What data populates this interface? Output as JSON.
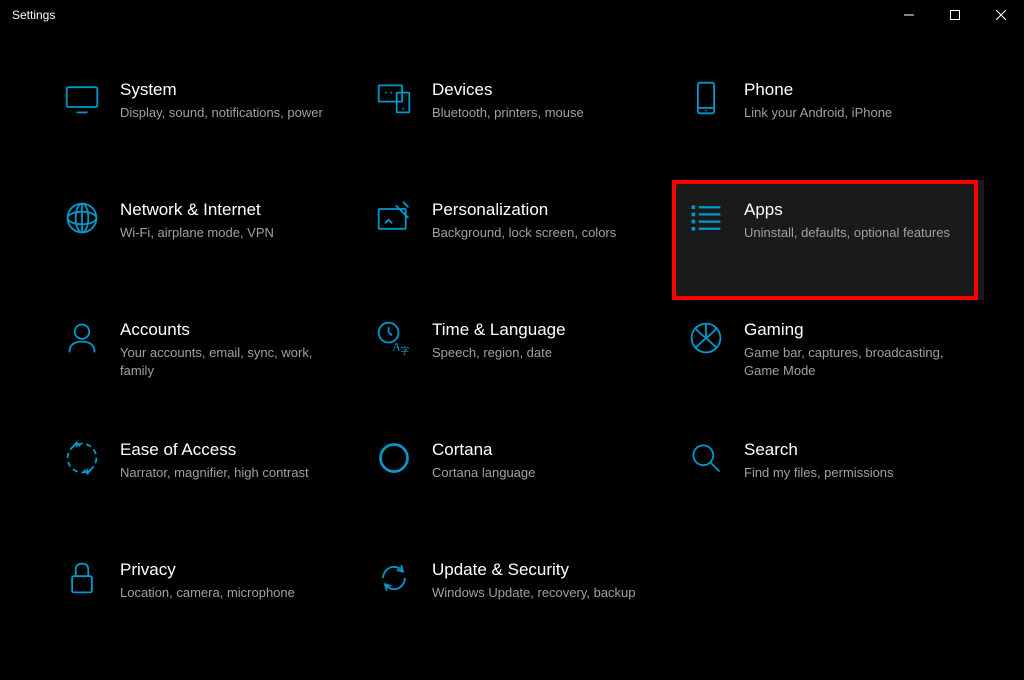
{
  "window": {
    "title": "Settings"
  },
  "categories": [
    {
      "title": "System",
      "description": "Display, sound, notifications, power"
    },
    {
      "title": "Devices",
      "description": "Bluetooth, printers, mouse"
    },
    {
      "title": "Phone",
      "description": "Link your Android, iPhone"
    },
    {
      "title": "Network & Internet",
      "description": "Wi-Fi, airplane mode, VPN"
    },
    {
      "title": "Personalization",
      "description": "Background, lock screen, colors"
    },
    {
      "title": "Apps",
      "description": "Uninstall, defaults, optional features"
    },
    {
      "title": "Accounts",
      "description": "Your accounts, email, sync, work, family"
    },
    {
      "title": "Time & Language",
      "description": "Speech, region, date"
    },
    {
      "title": "Gaming",
      "description": "Game bar, captures, broadcasting, Game Mode"
    },
    {
      "title": "Ease of Access",
      "description": "Narrator, magnifier, high contrast"
    },
    {
      "title": "Cortana",
      "description": "Cortana language"
    },
    {
      "title": "Search",
      "description": "Find my files, permissions"
    },
    {
      "title": "Privacy",
      "description": "Location, camera, microphone"
    },
    {
      "title": "Update & Security",
      "description": "Windows Update, recovery, backup"
    }
  ]
}
